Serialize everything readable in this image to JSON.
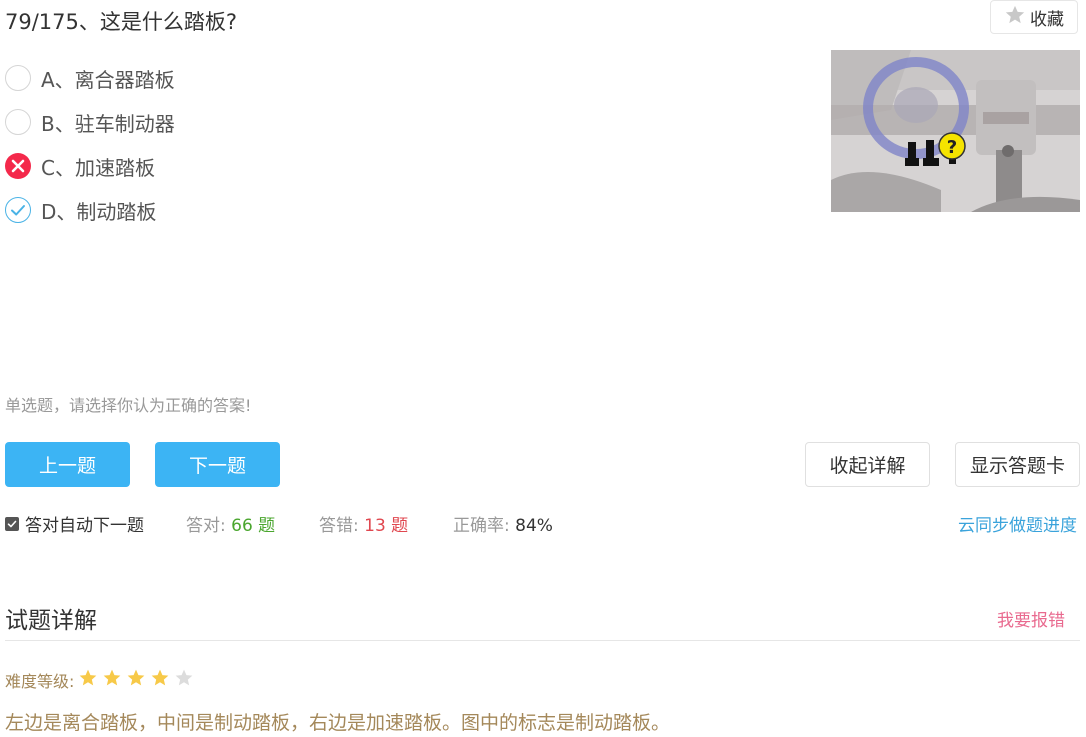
{
  "question": {
    "title": "79/175、这是什么踏板?",
    "favorite_label": "收藏",
    "type_hint": "单选题，请选择你认为正确的答案!",
    "options": [
      {
        "label": "A、离合器踏板",
        "state": "unselected"
      },
      {
        "label": "B、驻车制动器",
        "state": "unselected"
      },
      {
        "label": "C、加速踏板",
        "state": "wrong"
      },
      {
        "label": "D、制动踏板",
        "state": "correct"
      }
    ]
  },
  "buttons": {
    "prev": "上一题",
    "next": "下一题",
    "collapse": "收起详解",
    "answer_card": "显示答题卡"
  },
  "stats": {
    "auto_next_label": "答对自动下一题",
    "auto_next_checked": true,
    "correct_label": "答对:",
    "correct_value": "66 题",
    "wrong_label": "答错:",
    "wrong_value": "13 题",
    "accuracy_label": "正确率:",
    "accuracy_value": "84%",
    "sync_link": "云同步做题进度"
  },
  "explanation": {
    "heading": "试题详解",
    "report_link": "我要报错",
    "difficulty_label": "难度等级:",
    "difficulty_rating": 4,
    "difficulty_max": 5,
    "text": "左边是离合踏板，中间是制动踏板，右边是加速踏板。图中的标志是制动踏板。"
  },
  "colors": {
    "primary_button": "#3cb4f4",
    "wrong_mark": "#f4294b",
    "correct_mark": "#4ab3e6",
    "correct_count": "#4aa62e",
    "wrong_count": "#e0474f",
    "link": "#3aa3db",
    "report": "#e96a8f",
    "explanation_text": "#a4885a",
    "star_on": "#f7c948",
    "star_off": "#dcdcdc"
  },
  "icons": {
    "favorite": "star-icon",
    "wrong": "close-icon",
    "correct": "check-icon",
    "checkbox": "checkbox-checked-icon",
    "help": "question-mark-icon"
  }
}
